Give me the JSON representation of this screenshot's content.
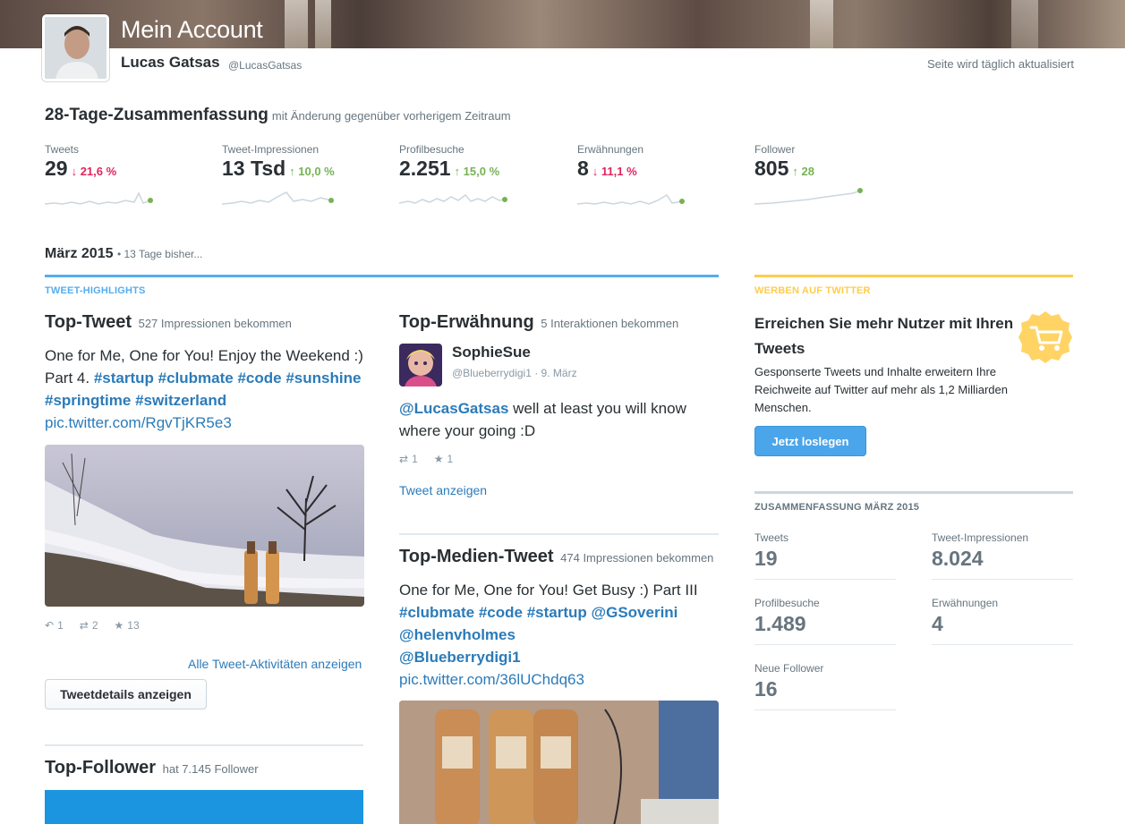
{
  "header": {
    "title": "Mein Account",
    "user_name": "Lucas Gatsas",
    "user_handle": "@LucasGatsas",
    "update_note": "Seite wird täglich aktualisiert"
  },
  "summary": {
    "title": "28-Tage-Zusammenfassung",
    "subtitle": "mit Änderung gegenüber vorherigem Zeitraum",
    "stats": [
      {
        "label": "Tweets",
        "value": "29",
        "change": "↓ 21,6 %",
        "direction": "down"
      },
      {
        "label": "Tweet-Impressionen",
        "value": "13 Tsd",
        "change": "↑ 10,0 %",
        "direction": "up"
      },
      {
        "label": "Profilbesuche",
        "value": "2.251",
        "change": "↑ 15,0 %",
        "direction": "up"
      },
      {
        "label": "Erwähnungen",
        "value": "8",
        "change": "↓ 11,1 %",
        "direction": "down"
      },
      {
        "label": "Follower",
        "value": "805",
        "change": "↑ 28",
        "direction": "up"
      }
    ]
  },
  "month": {
    "title": "März 2015",
    "subtitle": "• 13 Tage bisher..."
  },
  "highlights": {
    "label": "TWEET-HIGHLIGHTS",
    "top_tweet": {
      "title": "Top-Tweet",
      "subtitle": "527 Impressionen bekommen",
      "text_plain": "One for Me, One for You! Enjoy the Weekend :) Part 4.",
      "tags": [
        "#startup",
        "#clubmate",
        "#code",
        "#sunshine",
        "#springtime",
        "#switzerland"
      ],
      "link": "pic.twitter.com/RgvTjKR5e3",
      "replies": "1",
      "retweets": "2",
      "favorites": "13",
      "all_activity_link": "Alle Tweet-Aktivitäten anzeigen",
      "details_button": "Tweetdetails anzeigen"
    },
    "top_mention": {
      "title": "Top-Erwähnung",
      "subtitle": "5 Interaktionen bekommen",
      "name": "SophieSue",
      "handle_date": "@Blueberrydigi1 · 9. März",
      "mention": "@LucasGatsas",
      "text": "well at least you will know where your going :D",
      "retweets": "1",
      "favorites": "1",
      "view_link": "Tweet anzeigen"
    },
    "top_media": {
      "title": "Top-Medien-Tweet",
      "subtitle": "474 Impressionen bekommen",
      "text_plain": "One for Me, One for You! Get Busy :) Part III",
      "tags": [
        "#clubmate",
        "#code",
        "#startup",
        "@GSoverini",
        "@helenvholmes",
        "@Blueberrydigi1"
      ],
      "link": "pic.twitter.com/36lUChdq63"
    },
    "top_follower": {
      "title": "Top-Follower",
      "subtitle": "hat 7.145 Follower"
    }
  },
  "ad": {
    "label": "WERBEN AUF TWITTER",
    "title": "Erreichen Sie mehr Nutzer mit Ihren Tweets",
    "text": "Gesponserte Tweets und Inhalte erweitern Ihre Reichweite auf Twitter auf mehr als 1,2 Milliarden Menschen.",
    "button": "Jetzt loslegen",
    "icon": "cart-icon"
  },
  "month_summary": {
    "label": "ZUSAMMENFASSUNG MÄRZ 2015",
    "stats": [
      {
        "label": "Tweets",
        "value": "19"
      },
      {
        "label": "Tweet-Impressionen",
        "value": "8.024"
      },
      {
        "label": "Profilbesuche",
        "value": "1.489"
      },
      {
        "label": "Erwähnungen",
        "value": "4"
      },
      {
        "label": "Neue Follower",
        "value": "16"
      }
    ]
  },
  "colors": {
    "link": "#2b7bb9",
    "accent_blue": "#55acee",
    "accent_yellow": "#ffcc4d",
    "down": "#e0245e",
    "up": "#77b255"
  }
}
